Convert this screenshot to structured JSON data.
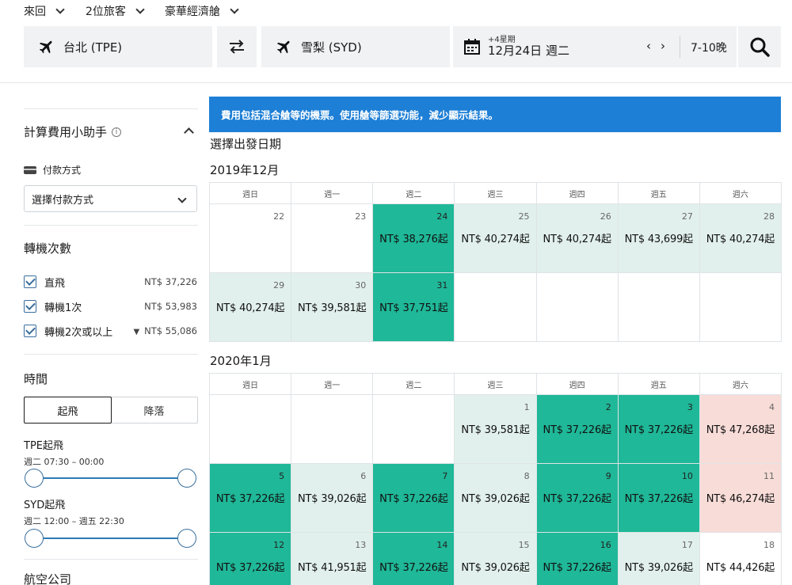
{
  "options": {
    "trip_type": "來回",
    "passengers": "2位旅客",
    "cabin": "豪華經濟艙"
  },
  "search": {
    "origin": "台北 (TPE)",
    "destination": "雪梨 (SYD)",
    "date_flex": "+4星期",
    "date": "12月24日 週二",
    "nights": "7-10晚"
  },
  "banner": "費用包括混合艙等的機票。使用艙等篩選功能，減少顯示結果。",
  "sidebar": {
    "calc_title": "計算費用小助手",
    "payment_label": "付款方式",
    "payment_select": "選擇付款方式",
    "stops_title": "轉機次數",
    "stops": [
      {
        "label": "直飛",
        "price": "NT$ 37,226"
      },
      {
        "label": "轉機1次",
        "price": "NT$ 53,983"
      },
      {
        "label": "轉機2次或以上",
        "price": "NT$ 55,086"
      }
    ],
    "time_title": "時間",
    "toggle_depart": "起飛",
    "toggle_land": "降落",
    "tpe_title": "TPE起飛",
    "tpe_range": "週二 07:30 – 00:00",
    "syd_title": "SYD起飛",
    "syd_range": "週二 12:00 – 週五 22:30",
    "airline_title": "航空公司"
  },
  "calendar": {
    "select_title": "選擇出發日期",
    "weekdays": [
      "週日",
      "週一",
      "週二",
      "週三",
      "週四",
      "週五",
      "週六"
    ],
    "months": [
      {
        "title": "2019年12月",
        "rows": [
          [
            {
              "d": "22",
              "p": "",
              "t": "plain"
            },
            {
              "d": "23",
              "p": "",
              "t": "plain"
            },
            {
              "d": "24",
              "p": "NT$ 38,276起",
              "t": "cheap"
            },
            {
              "d": "25",
              "p": "NT$ 40,274起",
              "t": "mid"
            },
            {
              "d": "26",
              "p": "NT$ 40,274起",
              "t": "mid"
            },
            {
              "d": "27",
              "p": "NT$ 43,699起",
              "t": "mid"
            },
            {
              "d": "28",
              "p": "NT$ 40,274起",
              "t": "mid"
            }
          ],
          [
            {
              "d": "29",
              "p": "NT$ 40,274起",
              "t": "mid"
            },
            {
              "d": "30",
              "p": "NT$ 39,581起",
              "t": "mid"
            },
            {
              "d": "31",
              "p": "NT$ 37,751起",
              "t": "cheap"
            },
            {
              "d": "",
              "p": "",
              "t": "plain"
            },
            {
              "d": "",
              "p": "",
              "t": "plain"
            },
            {
              "d": "",
              "p": "",
              "t": "plain"
            },
            {
              "d": "",
              "p": "",
              "t": "plain"
            }
          ]
        ]
      },
      {
        "title": "2020年1月",
        "rows": [
          [
            {
              "d": "",
              "p": "",
              "t": "plain"
            },
            {
              "d": "",
              "p": "",
              "t": "plain"
            },
            {
              "d": "",
              "p": "",
              "t": "plain"
            },
            {
              "d": "1",
              "p": "NT$ 39,581起",
              "t": "mid"
            },
            {
              "d": "2",
              "p": "NT$ 37,226起",
              "t": "cheap"
            },
            {
              "d": "3",
              "p": "NT$ 37,226起",
              "t": "cheap"
            },
            {
              "d": "4",
              "p": "NT$ 47,268起",
              "t": "high"
            }
          ],
          [
            {
              "d": "5",
              "p": "NT$ 37,226起",
              "t": "cheap"
            },
            {
              "d": "6",
              "p": "NT$ 39,026起",
              "t": "mid"
            },
            {
              "d": "7",
              "p": "NT$ 37,226起",
              "t": "cheap"
            },
            {
              "d": "8",
              "p": "NT$ 39,026起",
              "t": "mid"
            },
            {
              "d": "9",
              "p": "NT$ 37,226起",
              "t": "cheap"
            },
            {
              "d": "10",
              "p": "NT$ 37,226起",
              "t": "cheap"
            },
            {
              "d": "11",
              "p": "NT$ 46,274起",
              "t": "high"
            }
          ],
          [
            {
              "d": "12",
              "p": "NT$ 37,226起",
              "t": "cheap"
            },
            {
              "d": "13",
              "p": "NT$ 41,951起",
              "t": "mid"
            },
            {
              "d": "14",
              "p": "NT$ 37,226起",
              "t": "cheap"
            },
            {
              "d": "15",
              "p": "NT$ 39,026起",
              "t": "mid"
            },
            {
              "d": "16",
              "p": "NT$ 37,226起",
              "t": "cheap"
            },
            {
              "d": "17",
              "p": "NT$ 39,026起",
              "t": "mid"
            },
            {
              "d": "18",
              "p": "NT$ 44,426起",
              "t": "plain"
            }
          ]
        ]
      }
    ]
  },
  "colors": {
    "banner": "#1d7fd6",
    "cheap": "#1fb898",
    "mid": "#e1f0ec",
    "high": "#f8dcd8",
    "slider": "#2d7bb6"
  }
}
